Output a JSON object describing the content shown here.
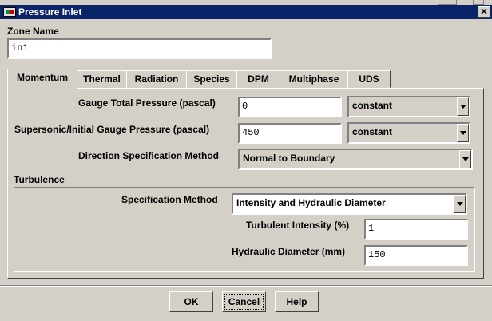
{
  "window": {
    "title": "Pressure Inlet"
  },
  "zone": {
    "label": "Zone Name",
    "value": "in1"
  },
  "tabs": [
    {
      "label": "Momentum",
      "active": true
    },
    {
      "label": "Thermal"
    },
    {
      "label": "Radiation"
    },
    {
      "label": "Species"
    },
    {
      "label": "DPM"
    },
    {
      "label": "Multiphase"
    },
    {
      "label": "UDS"
    }
  ],
  "momentum": {
    "gauge_total": {
      "label": "Gauge Total Pressure (pascal)",
      "value": "0",
      "method": "constant"
    },
    "supersonic": {
      "label": "Supersonic/Initial Gauge Pressure (pascal)",
      "value": "450",
      "method": "constant"
    },
    "direction": {
      "label": "Direction Specification Method",
      "value": "Normal to Boundary"
    }
  },
  "turbulence": {
    "label": "Turbulence",
    "spec_method": {
      "label": "Specification Method",
      "value": "Intensity and Hydraulic Diameter"
    },
    "intensity": {
      "label": "Turbulent Intensity (%)",
      "value": "1"
    },
    "hydraulic_diameter": {
      "label": "Hydraulic Diameter (mm)",
      "value": "150"
    }
  },
  "buttons": {
    "ok": "OK",
    "cancel": "Cancel",
    "help": "Help"
  },
  "icons": {
    "app": "fluent-app-icon",
    "close": "close-icon",
    "dropdown": "chevron-down-icon"
  },
  "colors": {
    "titlebar": "#0a246a",
    "face": "#d4d0c8"
  }
}
